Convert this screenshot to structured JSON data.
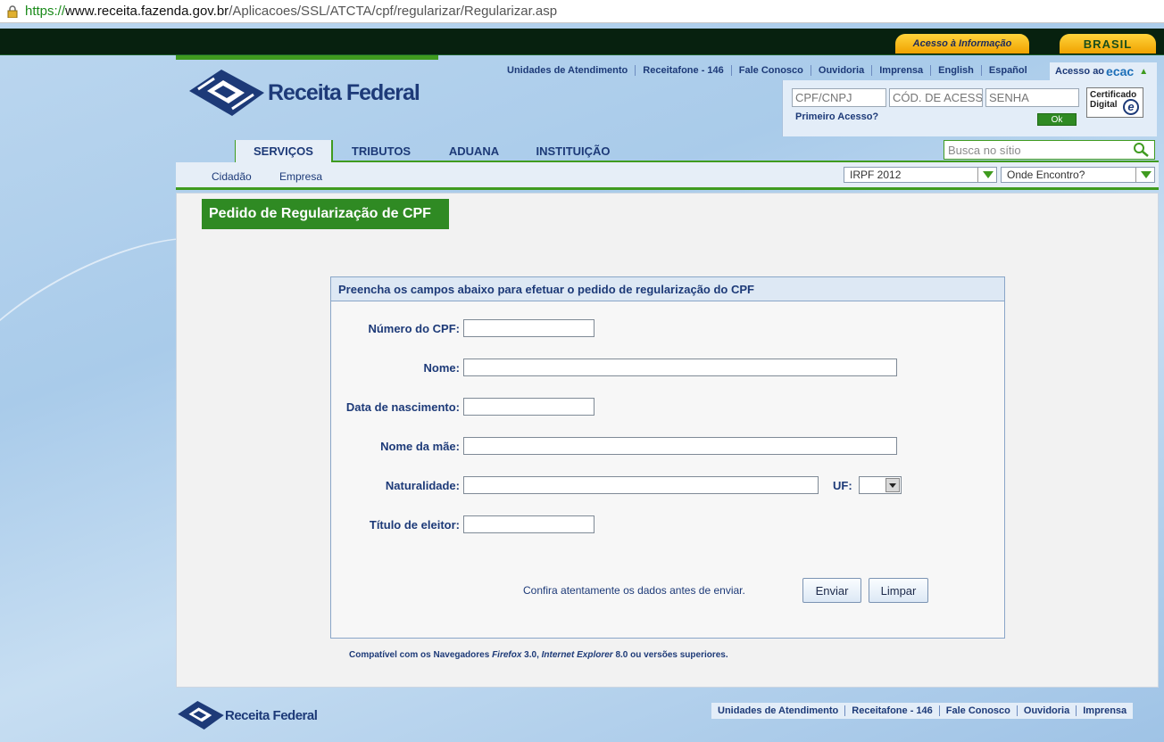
{
  "browser": {
    "url_scheme": "https://",
    "url_host": "www.receita.fazenda.gov.br",
    "url_path": "/Aplicacoes/SSL/ATCTA/cpf/regularizar/Regularizar.asp"
  },
  "gov_bar": {
    "acesso_informacao": "Acesso à Informação",
    "brasil": "BRASIL"
  },
  "header": {
    "logo_text": "Receita Federal",
    "top_links": [
      "Unidades de Atendimento",
      "Receitafone - 146",
      "Fale Conosco",
      "Ouvidoria",
      "Imprensa",
      "English",
      "Español"
    ],
    "acesso_ao": "Acesso ao",
    "ecac": "ecac"
  },
  "login": {
    "cpf_placeholder": "CPF/CNPJ",
    "codigo_placeholder": "CÓD. DE ACESSO",
    "senha_placeholder": "SENHA",
    "primeiro_acesso": "Primeiro Acesso?",
    "ok_label": "Ok",
    "cert_line1": "Certificado",
    "cert_line2": "Digital"
  },
  "nav": {
    "tabs": [
      "SERVIÇOS",
      "TRIBUTOS",
      "ADUANA",
      "INSTITUIÇÃO"
    ],
    "active_tab": "SERVIÇOS",
    "search_placeholder": "Busca no sítio",
    "sub_links": [
      "Cidadão",
      "Empresa"
    ],
    "dropdown_irpf": "IRPF 2012",
    "dropdown_onde": "Onde Encontro?"
  },
  "page": {
    "title": "Pedido de Regularização de CPF"
  },
  "form": {
    "header": "Preencha os campos abaixo para efetuar o pedido de regularização do CPF",
    "fields": {
      "cpf_label": "Número do CPF:",
      "nome_label": "Nome:",
      "nascimento_label": "Data de nascimento:",
      "mae_label": "Nome da mãe:",
      "naturalidade_label": "Naturalidade:",
      "uf_label": "UF:",
      "titulo_label": "Título de eleitor:"
    },
    "confira": "Confira atentamente os dados antes de enviar.",
    "enviar": "Enviar",
    "limpar": "Limpar"
  },
  "compat": {
    "prefix": "Compatível com os Navegadores ",
    "firefox": "Firefox",
    "firefox_ver": " 3.0, ",
    "ie": "Internet Explorer",
    "suffix": " 8.0 ou versões superiores."
  },
  "footer": {
    "logo_text": "Receita Federal",
    "links": [
      "Unidades de Atendimento",
      "Receitafone - 146",
      "Fale Conosco",
      "Ouvidoria",
      "Imprensa"
    ]
  },
  "colors": {
    "green": "#3f9b1f",
    "title_green": "#2f8a23",
    "navy": "#1d3a78",
    "gov_bar": "#07210f",
    "gold": "#ffd43b"
  }
}
